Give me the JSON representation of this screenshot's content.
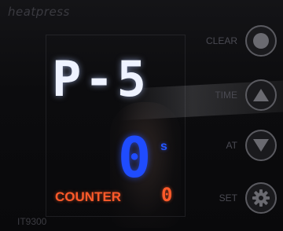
{
  "brand": "heatpress",
  "model": "IT9300",
  "display": {
    "program": "P-5",
    "time_value": "0",
    "time_unit": "s",
    "counter_label": "COUNTER",
    "counter_value": "0"
  },
  "buttons": {
    "clear": {
      "label": "CLEAR",
      "icon": "circle-icon"
    },
    "time": {
      "label": "TIME",
      "icon": "up-arrow-icon"
    },
    "at": {
      "label": "AT",
      "icon": "down-arrow-icon"
    },
    "set": {
      "label": "SET",
      "icon": "gear-icon"
    }
  },
  "colors": {
    "program_digits": "#eef2ff",
    "time_digits": "#1f4cff",
    "counter": "#ff5a2a",
    "button_gray": "#5a5a60"
  }
}
